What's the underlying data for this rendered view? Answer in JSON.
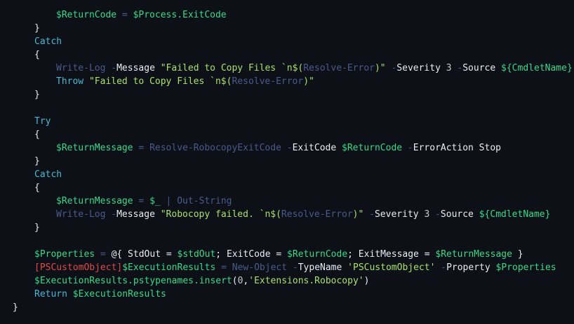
{
  "colors": {
    "background": "#0d1117",
    "plain": "#e6edf3",
    "keyword": "#4ab7d4",
    "variable": "#39d98a",
    "string": "#a8e06d",
    "parameter": "#e6edf3",
    "command": "#4a5a8c",
    "operator": "#4a5a8c",
    "number": "#c8c8c8",
    "type": "#e04a4a"
  },
  "lines": [
    {
      "indent": 1,
      "tokens": [
        {
          "t": "$ReturnCode",
          "k": "variable"
        },
        {
          "t": " = ",
          "k": "operator"
        },
        {
          "t": "$Process.ExitCode",
          "k": "variable"
        }
      ]
    },
    {
      "indent": 0,
      "tokens": [
        {
          "t": "}",
          "k": "plain"
        }
      ]
    },
    {
      "indent": 0,
      "tokens": [
        {
          "t": "Catch",
          "k": "keyword"
        }
      ]
    },
    {
      "indent": 0,
      "tokens": [
        {
          "t": "{",
          "k": "plain"
        }
      ]
    },
    {
      "indent": 1,
      "tokens": [
        {
          "t": "Write-Log",
          "k": "command"
        },
        {
          "t": " -",
          "k": "operator"
        },
        {
          "t": "Message",
          "k": "parameter"
        },
        {
          "t": " ",
          "k": "plain"
        },
        {
          "t": "\"Failed to Copy Files `n$(",
          "k": "string"
        },
        {
          "t": "Resolve-Error",
          "k": "command"
        },
        {
          "t": ")\"",
          "k": "string"
        },
        {
          "t": " -",
          "k": "operator"
        },
        {
          "t": "Severity",
          "k": "parameter"
        },
        {
          "t": " ",
          "k": "plain"
        },
        {
          "t": "3",
          "k": "number"
        },
        {
          "t": " -",
          "k": "operator"
        },
        {
          "t": "Source",
          "k": "parameter"
        },
        {
          "t": " ",
          "k": "plain"
        },
        {
          "t": "${CmdletName}",
          "k": "variable"
        }
      ]
    },
    {
      "indent": 1,
      "tokens": [
        {
          "t": "Throw",
          "k": "keyword"
        },
        {
          "t": " ",
          "k": "plain"
        },
        {
          "t": "\"Failed to Copy Files `n$(",
          "k": "string"
        },
        {
          "t": "Resolve-Error",
          "k": "command"
        },
        {
          "t": ")\"",
          "k": "string"
        }
      ]
    },
    {
      "indent": 0,
      "tokens": [
        {
          "t": "}",
          "k": "plain"
        }
      ]
    },
    {
      "indent": 0,
      "tokens": []
    },
    {
      "indent": 0,
      "tokens": [
        {
          "t": "Try",
          "k": "keyword"
        }
      ]
    },
    {
      "indent": 0,
      "tokens": [
        {
          "t": "{",
          "k": "plain"
        }
      ]
    },
    {
      "indent": 1,
      "tokens": [
        {
          "t": "$ReturnMessage",
          "k": "variable"
        },
        {
          "t": " = ",
          "k": "operator"
        },
        {
          "t": "Resolve-RobocopyExitCode",
          "k": "command"
        },
        {
          "t": " -",
          "k": "operator"
        },
        {
          "t": "ExitCode",
          "k": "parameter"
        },
        {
          "t": " ",
          "k": "plain"
        },
        {
          "t": "$ReturnCode",
          "k": "variable"
        },
        {
          "t": " -",
          "k": "operator"
        },
        {
          "t": "ErrorAction Stop",
          "k": "parameter"
        }
      ]
    },
    {
      "indent": 0,
      "tokens": [
        {
          "t": "}",
          "k": "plain"
        }
      ]
    },
    {
      "indent": 0,
      "tokens": [
        {
          "t": "Catch",
          "k": "keyword"
        }
      ]
    },
    {
      "indent": 0,
      "tokens": [
        {
          "t": "{",
          "k": "plain"
        }
      ]
    },
    {
      "indent": 1,
      "tokens": [
        {
          "t": "$ReturnMessage",
          "k": "variable"
        },
        {
          "t": " = ",
          "k": "operator"
        },
        {
          "t": "$_",
          "k": "variable"
        },
        {
          "t": " | ",
          "k": "operator"
        },
        {
          "t": "Out-String",
          "k": "command"
        }
      ]
    },
    {
      "indent": 1,
      "tokens": [
        {
          "t": "Write-Log",
          "k": "command"
        },
        {
          "t": " -",
          "k": "operator"
        },
        {
          "t": "Message",
          "k": "parameter"
        },
        {
          "t": " ",
          "k": "plain"
        },
        {
          "t": "\"Robocopy failed. `n$(",
          "k": "string"
        },
        {
          "t": "Resolve-Error",
          "k": "command"
        },
        {
          "t": ")\"",
          "k": "string"
        },
        {
          "t": " -",
          "k": "operator"
        },
        {
          "t": "Severity",
          "k": "parameter"
        },
        {
          "t": " ",
          "k": "plain"
        },
        {
          "t": "3",
          "k": "number"
        },
        {
          "t": " -",
          "k": "operator"
        },
        {
          "t": "Source",
          "k": "parameter"
        },
        {
          "t": " ",
          "k": "plain"
        },
        {
          "t": "${CmdletName}",
          "k": "variable"
        }
      ]
    },
    {
      "indent": 0,
      "tokens": [
        {
          "t": "}",
          "k": "plain"
        }
      ]
    },
    {
      "indent": 0,
      "tokens": []
    },
    {
      "indent": 0,
      "tokens": [
        {
          "t": "$Properties",
          "k": "variable"
        },
        {
          "t": " = ",
          "k": "operator"
        },
        {
          "t": "@{ StdOut = ",
          "k": "plain"
        },
        {
          "t": "$stdOut",
          "k": "variable"
        },
        {
          "t": "; ExitCode = ",
          "k": "plain"
        },
        {
          "t": "$ReturnCode",
          "k": "variable"
        },
        {
          "t": "; ExitMessage = ",
          "k": "plain"
        },
        {
          "t": "$ReturnMessage",
          "k": "variable"
        },
        {
          "t": " }",
          "k": "plain"
        }
      ]
    },
    {
      "indent": 0,
      "tokens": [
        {
          "t": "[PSCustomObject]",
          "k": "type"
        },
        {
          "t": "$ExecutionResults",
          "k": "variable"
        },
        {
          "t": " = ",
          "k": "operator"
        },
        {
          "t": "New-Object",
          "k": "command"
        },
        {
          "t": " -",
          "k": "operator"
        },
        {
          "t": "TypeName",
          "k": "parameter"
        },
        {
          "t": " ",
          "k": "plain"
        },
        {
          "t": "'PSCustomObject'",
          "k": "string"
        },
        {
          "t": " -",
          "k": "operator"
        },
        {
          "t": "Property",
          "k": "parameter"
        },
        {
          "t": " ",
          "k": "plain"
        },
        {
          "t": "$Properties",
          "k": "variable"
        }
      ]
    },
    {
      "indent": 0,
      "tokens": [
        {
          "t": "$ExecutionResults.pstypenames.insert",
          "k": "variable"
        },
        {
          "t": "(",
          "k": "plain"
        },
        {
          "t": "0",
          "k": "number"
        },
        {
          "t": ",",
          "k": "plain"
        },
        {
          "t": "'Extensions.Robocopy'",
          "k": "string"
        },
        {
          "t": ")",
          "k": "plain"
        }
      ]
    },
    {
      "indent": 0,
      "tokens": [
        {
          "t": "Return",
          "k": "keyword"
        },
        {
          "t": " ",
          "k": "plain"
        },
        {
          "t": "$ExecutionResults",
          "k": "variable"
        }
      ]
    },
    {
      "indent": -1,
      "tokens": [
        {
          "t": "}",
          "k": "plain"
        }
      ]
    }
  ]
}
